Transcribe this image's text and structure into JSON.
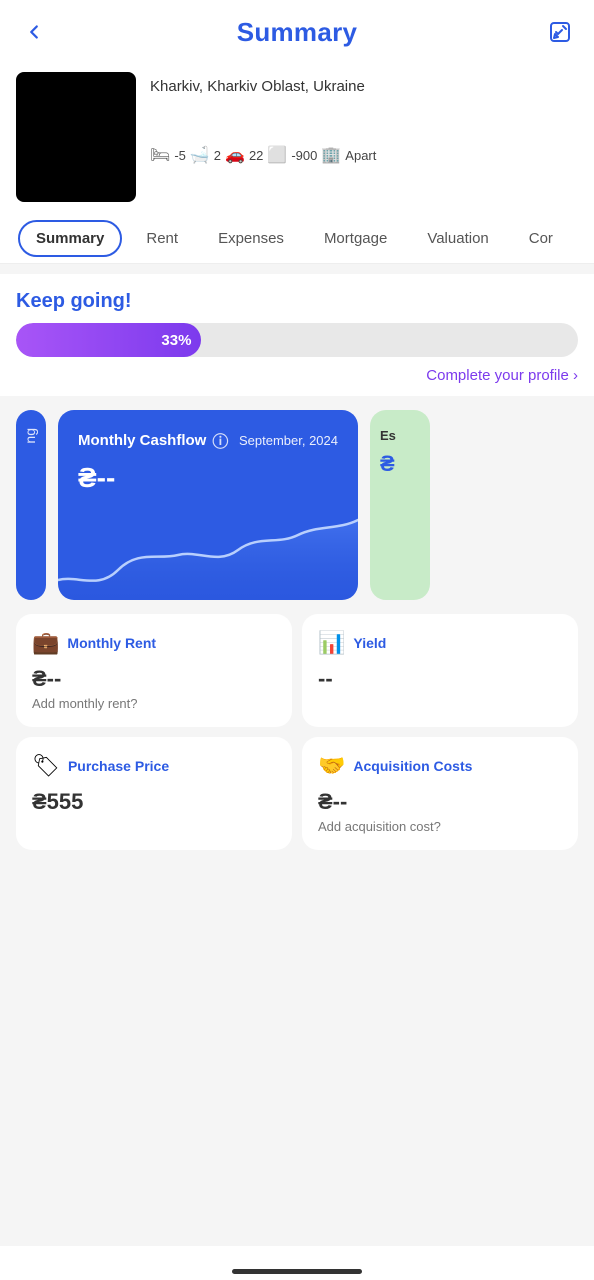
{
  "header": {
    "title": "Summary",
    "back_label": "back",
    "edit_label": "edit"
  },
  "property": {
    "location": "Kharkiv, Kharkiv Oblast, Ukraine",
    "stats": [
      {
        "icon": "🛏",
        "value": "-5"
      },
      {
        "icon": "🛁",
        "value": "2"
      },
      {
        "icon": "🚗",
        "value": "22"
      },
      {
        "icon": "⬜",
        "value": "-900"
      },
      {
        "icon": "🏢",
        "value": "Apart"
      }
    ]
  },
  "tabs": [
    {
      "label": "Summary",
      "active": true
    },
    {
      "label": "Rent",
      "active": false
    },
    {
      "label": "Expenses",
      "active": false
    },
    {
      "label": "Mortgage",
      "active": false
    },
    {
      "label": "Valuation",
      "active": false
    },
    {
      "label": "Cor",
      "active": false
    }
  ],
  "profile": {
    "heading": "Keep going!",
    "progress_percent": 33,
    "progress_label": "33%",
    "complete_link": "Complete your profile ›"
  },
  "cashflow": {
    "title": "Monthly Cashflow",
    "date": "September, 2024",
    "value": "₴--",
    "info_icon": "ⓘ"
  },
  "est_card": {
    "prefix": "Es",
    "value": "₴"
  },
  "metric_cards": [
    {
      "icon": "💼",
      "title": "Monthly Rent",
      "value": "₴--",
      "sub": "Add monthly rent?"
    },
    {
      "icon": "📊",
      "title": "Yield",
      "value": "--",
      "sub": ""
    },
    {
      "icon": "🏷",
      "title": "Purchase Price",
      "value": "₴555",
      "sub": ""
    },
    {
      "icon": "🤝",
      "title": "Acquisition Costs",
      "value": "₴--",
      "sub": "Add acquisition cost?"
    }
  ]
}
